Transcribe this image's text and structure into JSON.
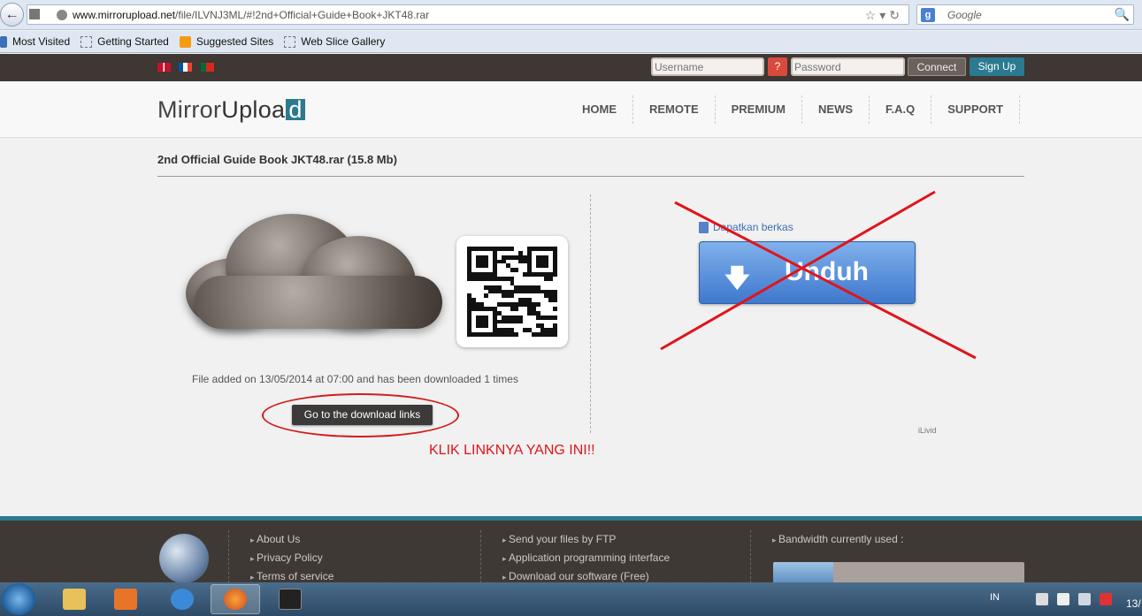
{
  "browser": {
    "url_domain": "www.mirrorupload.net",
    "url_path": "/file/ILVNJ3ML/#!2nd+Official+Guide+Book+JKT48.rar",
    "search_placeholder": "Google",
    "bookmarks": [
      "Most Visited",
      "Getting Started",
      "Suggested Sites",
      "Web Slice Gallery"
    ]
  },
  "topbar": {
    "username_placeholder": "Username",
    "help_label": "?",
    "password_placeholder": "Password",
    "connect_label": "Connect",
    "signup_label": "Sign Up",
    "languages": [
      "English flag",
      "French flag",
      "Portuguese flag"
    ]
  },
  "header": {
    "logo_a": "Mirror",
    "logo_b": "Uploa",
    "logo_c": "d",
    "nav": [
      "HOME",
      "REMOTE",
      "PREMIUM",
      "NEWS",
      "F.A.Q",
      "SUPPORT"
    ]
  },
  "file": {
    "title": "2nd Official Guide Book JKT48.rar (15.8 Mb)",
    "info": "File added on 13/05/2014 at 07:00 and has been downloaded 1 times",
    "download_links_label": "Go to the download links",
    "annotation": "KLIK LINKNYA YANG INI!!"
  },
  "ad": {
    "caption": "Dapatkan berkas",
    "button_label": "Unduh",
    "brand": "iLivid"
  },
  "footer": {
    "col1": [
      "About Us",
      "Privacy Policy",
      "Terms of service"
    ],
    "col2": [
      "Send your files by FTP",
      "Application programming interface",
      "Download our software (Free)"
    ],
    "bandwidth_label": "Bandwidth used :",
    "bandwidth_label_full": "Bandwidth currently used :",
    "bandwidth_fraction": 0.24
  },
  "taskbar": {
    "lang": "IN",
    "clock": "13/"
  },
  "colors": {
    "accent": "#2b7a8f",
    "topbar": "#3e3733",
    "annotation_red": "#e0141b"
  }
}
